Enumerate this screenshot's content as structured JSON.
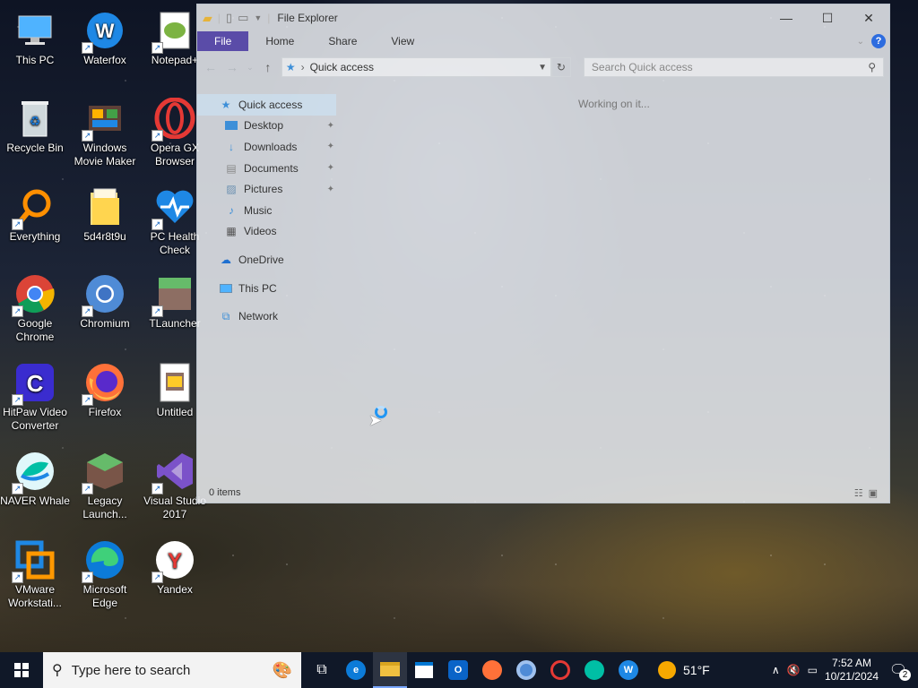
{
  "desktop": {
    "icons": [
      {
        "label": "This PC"
      },
      {
        "label": "Waterfox"
      },
      {
        "label": "Notepad+"
      },
      {
        "label": "Recycle Bin"
      },
      {
        "label": "Windows Movie Maker"
      },
      {
        "label": "Opera GX Browser"
      },
      {
        "label": "Everything"
      },
      {
        "label": "5d4r8t9u"
      },
      {
        "label": "PC Health Check"
      },
      {
        "label": "Google Chrome"
      },
      {
        "label": "Chromium"
      },
      {
        "label": "TLauncher"
      },
      {
        "label": "HitPaw Video Converter"
      },
      {
        "label": "Firefox"
      },
      {
        "label": "Untitled"
      },
      {
        "label": "NAVER Whale"
      },
      {
        "label": "Legacy Launch..."
      },
      {
        "label": "Visual Studio 2017"
      },
      {
        "label": "VMware Workstati..."
      },
      {
        "label": "Microsoft Edge"
      },
      {
        "label": "Yandex"
      }
    ]
  },
  "explorer": {
    "title": "File Explorer",
    "ribbon_tabs": [
      "File",
      "Home",
      "Share",
      "View"
    ],
    "address": "Quick access",
    "search_placeholder": "Search Quick access",
    "status_text": "Working on it...",
    "item_count": "0 items",
    "nav": [
      {
        "label": "Quick access"
      },
      {
        "label": "Desktop"
      },
      {
        "label": "Downloads"
      },
      {
        "label": "Documents"
      },
      {
        "label": "Pictures"
      },
      {
        "label": "Music"
      },
      {
        "label": "Videos"
      },
      {
        "label": "OneDrive"
      },
      {
        "label": "This PC"
      },
      {
        "label": "Network"
      }
    ]
  },
  "taskbar": {
    "search_placeholder": "Type here to search",
    "weather": "51°F",
    "time": "7:52 AM",
    "date": "10/21/2024",
    "notification_count": "2"
  },
  "colors": {
    "file_tab": "#5a4ca8",
    "taskbar": "#101828",
    "accent": "#2d6cdf"
  }
}
